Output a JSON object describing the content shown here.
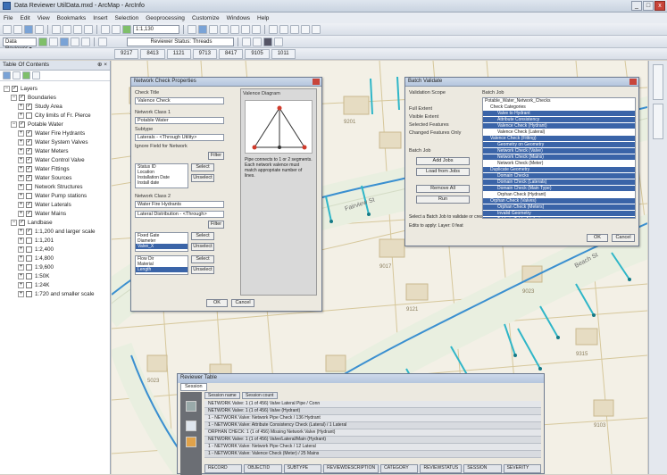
{
  "window": {
    "title": "Data Reviewer UtilData.mxd - ArcMap - ArcInfo",
    "minimize": "_",
    "maximize": "□",
    "close": "x"
  },
  "menu": [
    "File",
    "Edit",
    "View",
    "Bookmarks",
    "Insert",
    "Selection",
    "Geoprocessing",
    "Customize",
    "Windows",
    "Help"
  ],
  "toolbar": {
    "scale": "1:1,130",
    "reviewer_combo": "Data Reviewer ▾",
    "status": "Reviewer Status: Threads",
    "map_tabs": [
      "9217",
      "8413",
      "1121",
      "9713",
      "8417",
      "9105",
      "1011"
    ]
  },
  "toc": {
    "title": "Table Of Contents",
    "close": "⊕ ×",
    "items": [
      {
        "label": "Layers",
        "level": 0,
        "exp": "−",
        "checked": true
      },
      {
        "label": "Boundaries",
        "level": 1,
        "exp": "−",
        "checked": true
      },
      {
        "label": "Study Area",
        "level": 2,
        "exp": "+",
        "checked": true
      },
      {
        "label": "City limits of Fr. Pierce",
        "level": 2,
        "exp": "+",
        "checked": false
      },
      {
        "label": "Potable Water",
        "level": 1,
        "exp": "−",
        "checked": true
      },
      {
        "label": "Water Fire Hydrants",
        "level": 2,
        "exp": "+",
        "checked": true
      },
      {
        "label": "Water System Valves",
        "level": 2,
        "exp": "+",
        "checked": true
      },
      {
        "label": "Water Meters",
        "level": 2,
        "exp": "+",
        "checked": true
      },
      {
        "label": "Water Control Valve",
        "level": 2,
        "exp": "+",
        "checked": true
      },
      {
        "label": "Water Fittings",
        "level": 2,
        "exp": "+",
        "checked": true
      },
      {
        "label": "Water Sources",
        "level": 2,
        "exp": "+",
        "checked": true
      },
      {
        "label": "Network Structures",
        "level": 2,
        "exp": "+",
        "checked": false
      },
      {
        "label": "Water Pump stations",
        "level": 2,
        "exp": "+",
        "checked": false
      },
      {
        "label": "Water Laterals",
        "level": 2,
        "exp": "+",
        "checked": true
      },
      {
        "label": "Water Mains",
        "level": 2,
        "exp": "+",
        "checked": true
      },
      {
        "label": "Landbase",
        "level": 1,
        "exp": "−",
        "checked": true
      },
      {
        "label": "1:1,200 and larger scale",
        "level": 2,
        "exp": "+",
        "checked": true
      },
      {
        "label": "1:1,201",
        "level": 2,
        "exp": "+",
        "checked": false
      },
      {
        "label": "1:2,400",
        "level": 2,
        "exp": "+",
        "checked": false
      },
      {
        "label": "1:4,800",
        "level": 2,
        "exp": "+",
        "checked": false
      },
      {
        "label": "1:9,600",
        "level": 2,
        "exp": "+",
        "checked": false
      },
      {
        "label": "1:50K",
        "level": 2,
        "exp": "+",
        "checked": false
      },
      {
        "label": "1:24K",
        "level": 2,
        "exp": "+",
        "checked": false
      },
      {
        "label": "1:720 and smaller scale",
        "level": 2,
        "exp": "+",
        "checked": false
      }
    ]
  },
  "map": {
    "street_labels": [
      "Fairview St",
      "Beach St"
    ],
    "parcel_numbers": [
      "1011",
      "9007",
      "9413",
      "9017",
      "9121",
      "9023",
      "9315",
      "1105",
      "9217",
      "9103",
      "5023",
      "5921",
      "9201"
    ]
  },
  "check_props": {
    "title": "Network Check Properties",
    "check_title_label": "Check Title",
    "check_title": "Valence Check",
    "network_label": "Network Class 1",
    "network_value": "Potable Water",
    "subtype_label": "Subtype",
    "subtype_value": "Laterals - <Through Utility>",
    "ignore_label": "Ignore Field for Network",
    "network_label2": "Network Class 2",
    "network_value2": "Water Fire Hydrants",
    "subtype_value2": "Lateral Distribution - <Through>",
    "btn_ok": "OK",
    "btn_cancel": "Cancel",
    "btn_select": "Select",
    "btn_unselect": "Unselect",
    "btn_filter": "Filter",
    "list1": [
      "Status ID",
      "Location",
      "Installation Date",
      "Install date"
    ],
    "list2": [
      "Fixed Gate",
      "Diameter",
      "Valve_X"
    ],
    "list3": [
      "Flow Dir",
      "Material",
      "Length"
    ],
    "valence_title": "Valence Diagram",
    "diagram_caption": "Pipe connects to 1 or 2 segments. Each network valence must match appropriate number of lines."
  },
  "batch": {
    "title": "Batch Validate",
    "section1": "Validation Scope",
    "opt1": "Full Extent",
    "opt2": "Visible Extent",
    "opt3": "Selected Features",
    "opt4": "Changed Features Only",
    "section2": "Batch Job",
    "btn_add": "Add Jobs",
    "btn_load": "Load from Jobs",
    "btn_remove": "Remove All",
    "btn_run": "Run",
    "tree_title": "Batch Job",
    "tree_items": [
      "Potable_Water_Network_Checks",
      "Check Categories",
      "Valve to Hydrant",
      "Attribute Consistency",
      "Valence Check (Hydrant)",
      "Valence Check (Lateral)",
      "Valence Check (Fitting)",
      "Geometry on Geometry",
      "Network Check (Valve)",
      "Network Check (Mains)",
      "Network Check (Meter)",
      "Duplicate Geometry",
      "Domain Checks",
      "Domain Check (Laterals)",
      "Domain Check (Main Type)",
      "Orphan Check (Hydrant)",
      "Orphan Check (Valves)",
      "Orphan Check (Meters)",
      "Invalid Geometry",
      "Table to Table Attribute",
      "Table to Table (Hydrants)",
      "Table to Table (Valves)"
    ],
    "note": "Select a Batch Job to validate or create a new batch job.",
    "status": "Edits to apply: Layer: 0 feat",
    "btn_ok": "OK",
    "btn_cancel": "Cancel"
  },
  "results": {
    "title": "Reviewer Table",
    "tab": "Session",
    "col1": "Session name",
    "col2": "Session count",
    "rows": [
      "NETWORK Valve: 1 (1 of 456) Valve Lateral Pipe / Conn",
      "NETWORK Valve: 1 (1 of 456) Valve (Hydrant)",
      "1 - NETWORK Valve: Network Pipe Check / 136 Hydrant",
      "1 - NETWORK Valve: Attribute Consistency Check (Lateral) / 1 Lateral",
      "ORPHAN CHECK: 1 (1 of 456) Missing Network Valve (Hydrant)",
      "NETWORK Valve: 1 (1 of 456) Valve/Lateral/Main (Hydrant)",
      "1 - NETWORK Valve: Network Pipe Check / 12 Lateral",
      "1 - NETWORK Valve: Valence Check (Meter) / 25 Mains"
    ],
    "footer_cols": [
      "RECORD",
      "OBJECTID",
      "SUBTYPE",
      "REVIEWDESCRIPTION",
      "CATEGORY",
      "REVIEWSTATUS",
      "SESSION",
      "SEVERITY"
    ]
  }
}
